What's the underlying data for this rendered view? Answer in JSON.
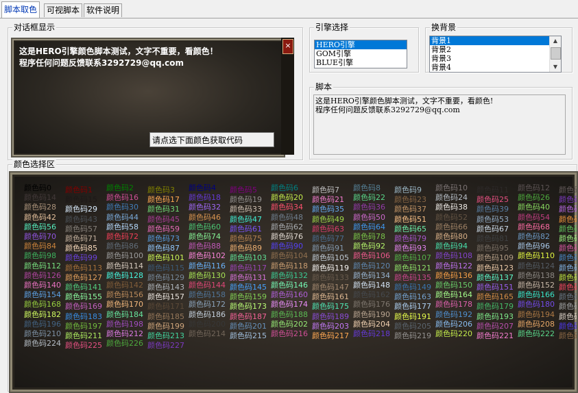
{
  "tabs": [
    "脚本取色",
    "可视脚本",
    "软件说明"
  ],
  "dialog_group": {
    "title": "对话框显示"
  },
  "dialog": {
    "line1": "这是HERO引擎颜色脚本测试，文字不重要，看颜色！",
    "line2": "程序任何问题反馈联系3292729@qq.com",
    "close_glyph": "×",
    "button_label": "请点选下面颜色获取代码"
  },
  "engine": {
    "title": "引擎选择",
    "items": [
      "HERO引擎",
      "GOM引擎",
      "BLUE引擎"
    ],
    "selected": 0
  },
  "background": {
    "title": "换背景",
    "items": [
      "背景1",
      "背景2",
      "背景3",
      "背景4"
    ],
    "selected": 0
  },
  "script": {
    "title": "脚本",
    "line1": "这是HERO引擎颜色脚本测试，文字不重要，看颜色!",
    "line2": "程序任何问题反馈联系3292729@qq.com"
  },
  "color_area": {
    "title": "颜色选择区",
    "prefix": "颜色码",
    "cols": 14,
    "count": 228
  }
}
